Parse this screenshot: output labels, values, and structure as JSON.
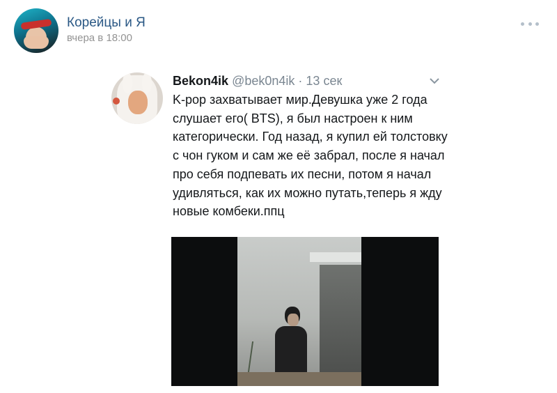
{
  "post": {
    "group_name": "Корейцы и Я",
    "time": "вчера в 18:00",
    "more_icon": "more-horizontal-icon"
  },
  "tweet": {
    "display_name": "Bekon4ik",
    "handle": "@bek0n4ik",
    "separator": "·",
    "time": "13 сек",
    "menu_icon": "chevron-down-icon",
    "text": "K-pop захватывает мир.Девушка уже 2 года слушает его( BTS), я  был настроен к ним категорически. Год назад, я купил ей толстовку с чон гуком и сам же её забрал, после я начал про себя подпевать их песни, потом я начал удивляться, как их можно путать,теперь я жду новые комбеки.ппц",
    "media": {
      "description_icon": "photo-icon"
    }
  },
  "colors": {
    "link_blue": "#2a5885",
    "meta_gray": "#939393",
    "text": "#14171a"
  }
}
